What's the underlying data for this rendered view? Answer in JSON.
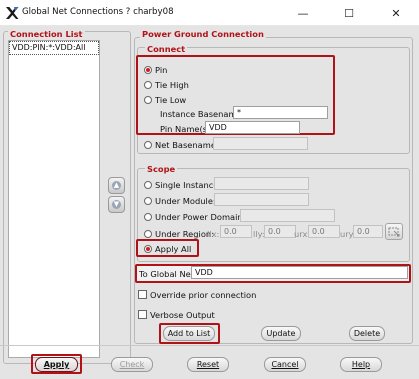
{
  "window": {
    "title": "Global Net Connections ? charby08",
    "logo": "X",
    "controls": {
      "minimize": "—",
      "maximize": "☐",
      "close": "✕"
    }
  },
  "connection_list": {
    "title": "Connection List",
    "items": [
      "VDD:PIN:*:VDD:All"
    ]
  },
  "pgc": {
    "title": "Power Ground Connection",
    "connect": {
      "title": "Connect",
      "options": {
        "pin": "Pin",
        "tie_high": "Tie High",
        "tie_low": "Tie Low"
      },
      "selected": "Pin",
      "instance_basename_label": "Instance Basename:",
      "instance_basename_value": "*",
      "pin_names_label": "Pin Name(s):",
      "pin_names_value": "VDD",
      "net_basename_label": "Net Basename:",
      "net_basename_value": ""
    },
    "scope": {
      "title": "Scope",
      "single_instance": "Single Instance:",
      "under_module": "Under Module:",
      "under_power_domain": "Under Power Domain:",
      "under_region": "Under Region:",
      "llx_label": "llx:",
      "llx": "0.0",
      "lly_label": "lly:",
      "lly": "0.0",
      "urx_label": "urx:",
      "urx": "0.0",
      "ury_label": "ury:",
      "ury": "0.0",
      "apply_all": "Apply All",
      "selected": "Apply All"
    },
    "to_global_net_label": "To Global Net:",
    "to_global_net_value": "VDD",
    "override_prior": "Override prior connection",
    "verbose_output": "Verbose Output",
    "add_to_list": "Add to List",
    "update": "Update",
    "delete": "Delete"
  },
  "footer": {
    "apply": "Apply",
    "check": "Check",
    "reset": "Reset",
    "cancel": "Cancel",
    "help": "Help"
  },
  "colors": {
    "accent_red": "#b31217",
    "window_bg": "#e4e4e4",
    "highlight_box": "#b01218"
  }
}
